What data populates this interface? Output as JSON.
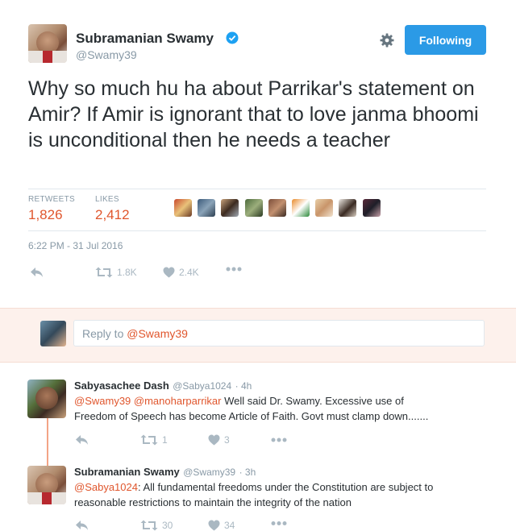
{
  "author": {
    "name": "Subramanian Swamy",
    "handle": "@Swamy39",
    "follow_label": "Following"
  },
  "tweet": {
    "text": "Why so much hu ha about Parrikar's statement on Amir? If Amir is ignorant that to love janma bhoomi is unconditional then he needs a teacher",
    "retweets_label": "RETWEETS",
    "retweets_value": "1,826",
    "likes_label": "LIKES",
    "likes_value": "2,412",
    "timestamp": "6:22 PM - 31 Jul 2016",
    "actions": {
      "retweet_count": "1.8K",
      "like_count": "2.4K"
    }
  },
  "reply_box": {
    "placeholder_prefix": "Reply to ",
    "placeholder_mention": "@Swamy39"
  },
  "replies": [
    {
      "name": "Sabyasachee Dash",
      "handle": "@Sabya1024",
      "time": "· 4h",
      "mention1": "@Swamy39",
      "mention2": "@manoharparrikar",
      "text_line1_rest": " Well said Dr. Swamy. Excessive use of",
      "text_line2": "Freedom of  Speech has become Article of Faith. Govt must clamp down.......",
      "retweet_count": "1",
      "like_count": "3"
    },
    {
      "name": "Subramanian Swamy",
      "handle": "@Swamy39",
      "time": "· 3h",
      "mention1": "@Sabya1024",
      "text_line1_rest": ": All fundamental freedoms under the Constitution are subject to",
      "text_line2": "reasonable restrictions to maintain the integrity of the nation",
      "retweet_count": "30",
      "like_count": "34"
    }
  ],
  "colors": {
    "accent": "#e0562d",
    "follow_button": "#2b9ae6",
    "verified": "#1da1f2",
    "reply_band": "#fdf1ec"
  }
}
